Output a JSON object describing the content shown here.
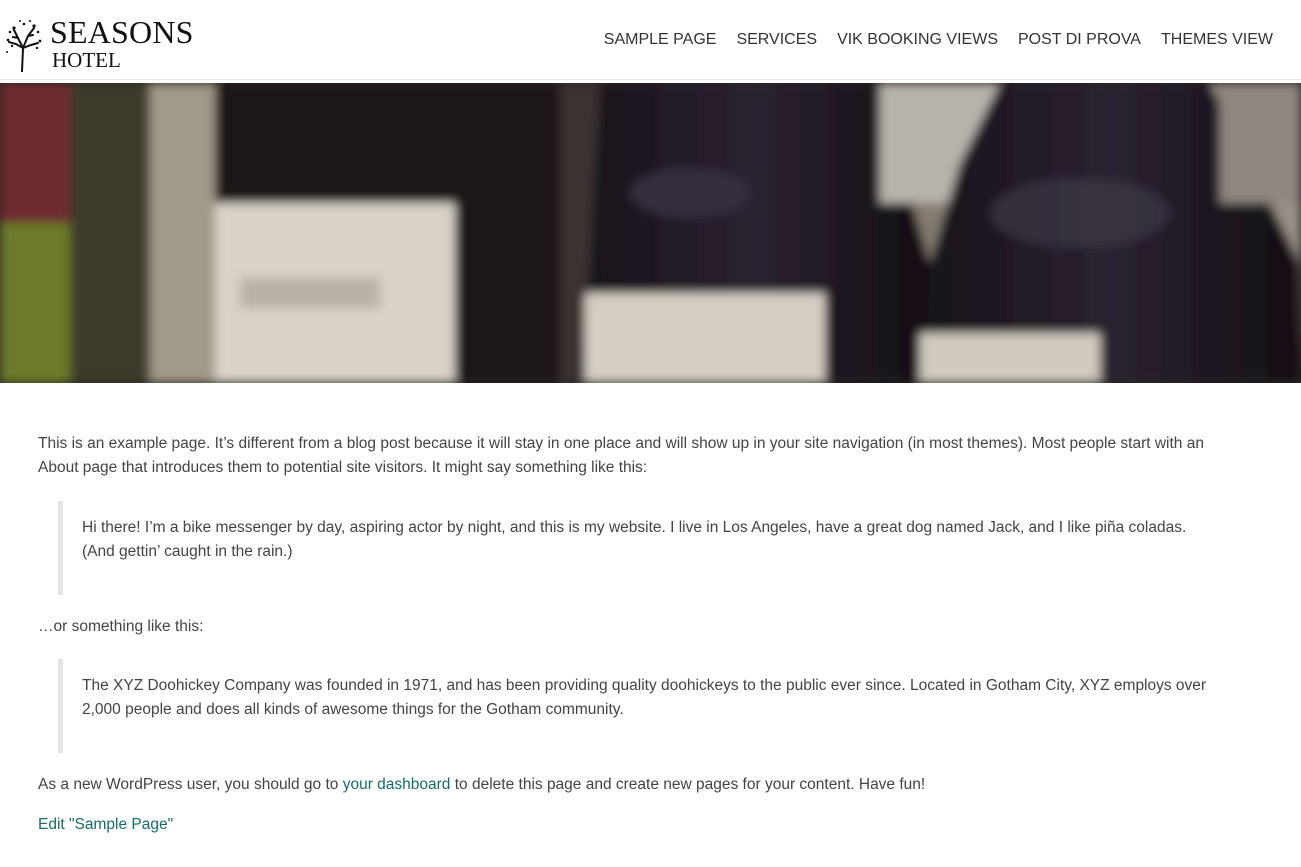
{
  "brand": {
    "line1": "SEASONS",
    "line2": "HOTEL"
  },
  "nav": {
    "items": [
      {
        "label": "SAMPLE PAGE"
      },
      {
        "label": "SERVICES"
      },
      {
        "label": "VIK BOOKING VIEWS"
      },
      {
        "label": "POST DI PROVA"
      },
      {
        "label": "THEMES VIEW"
      }
    ]
  },
  "hero": {
    "icon": "wine-bottles-photo"
  },
  "content": {
    "intro": "This is an example page. It’s different from a blog post because it will stay in one place and will show up in your site navigation (in most themes). Most people start with an About page that introduces them to potential site visitors. It might say something like this:",
    "quote1": "Hi there! I’m a bike messenger by day, aspiring actor by night, and this is my website. I live in Los Angeles, have a great dog named Jack, and I like piña coladas. (And gettin’ caught in the rain.)",
    "or_text": "…or something like this:",
    "quote2": "The XYZ Doohickey Company was founded in 1971, and has been providing quality doohickeys to the public ever since. Located in Gotham City, XYZ employs over 2,000 people and does all kinds of awesome things for the Gotham community.",
    "outro_before": "As a new WordPress user, you should go to ",
    "outro_link": "your dashboard",
    "outro_after": " to delete this page and create new pages for your content. Have fun!",
    "edit_link": "Edit \"Sample Page\""
  },
  "colors": {
    "link": "#1a6a6a",
    "text": "#444444",
    "nav_text": "#333333"
  }
}
